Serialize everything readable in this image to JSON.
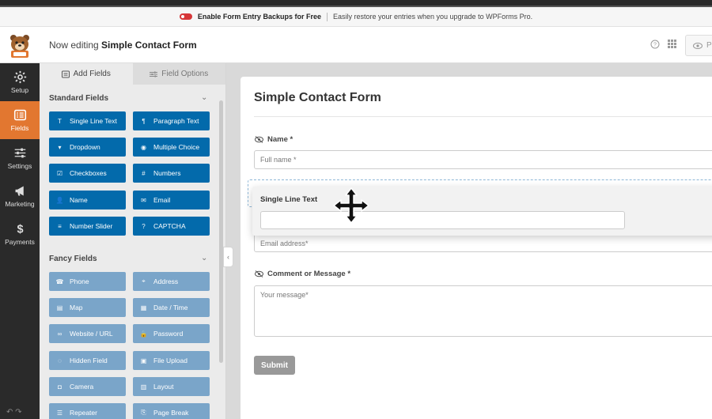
{
  "notice": {
    "title": "Enable Form Entry Backups for Free",
    "description": "Easily restore your entries when you upgrade to WPForms Pro."
  },
  "header": {
    "editing_prefix": "Now editing",
    "form_name": "Simple Contact Form",
    "help_icon": "help-icon",
    "grid_icon": "grid-icon",
    "preview_label": "P"
  },
  "nav": {
    "items": [
      {
        "label": "Setup",
        "icon": "gear-icon"
      },
      {
        "label": "Fields",
        "icon": "fields-list-icon",
        "active": true
      },
      {
        "label": "Settings",
        "icon": "sliders-icon"
      },
      {
        "label": "Marketing",
        "icon": "megaphone-icon"
      },
      {
        "label": "Payments",
        "icon": "dollar-icon"
      }
    ]
  },
  "panel": {
    "tabs": [
      {
        "label": "Add Fields",
        "active": true
      },
      {
        "label": "Field Options",
        "active": false
      }
    ],
    "standard_title": "Standard Fields",
    "standard_fields": [
      {
        "label": "Single Line Text",
        "icon": "T"
      },
      {
        "label": "Paragraph Text",
        "icon": "¶"
      },
      {
        "label": "Dropdown",
        "icon": "▾"
      },
      {
        "label": "Multiple Choice",
        "icon": "◉"
      },
      {
        "label": "Checkboxes",
        "icon": "☑"
      },
      {
        "label": "Numbers",
        "icon": "#"
      },
      {
        "label": "Name",
        "icon": "👤"
      },
      {
        "label": "Email",
        "icon": "✉"
      },
      {
        "label": "Number Slider",
        "icon": "≡"
      },
      {
        "label": "CAPTCHA",
        "icon": "?"
      }
    ],
    "fancy_title": "Fancy Fields",
    "fancy_fields": [
      {
        "label": "Phone",
        "icon": "☎"
      },
      {
        "label": "Address",
        "icon": "⌖"
      },
      {
        "label": "Map",
        "icon": "▤"
      },
      {
        "label": "Date / Time",
        "icon": "▦"
      },
      {
        "label": "Website / URL",
        "icon": "∞"
      },
      {
        "label": "Password",
        "icon": "🔒"
      },
      {
        "label": "Hidden Field",
        "icon": "◌"
      },
      {
        "label": "File Upload",
        "icon": "▣"
      },
      {
        "label": "Camera",
        "icon": "◘"
      },
      {
        "label": "Layout",
        "icon": "▥"
      },
      {
        "label": "Repeater",
        "icon": "☰"
      },
      {
        "label": "Page Break",
        "icon": "⎘"
      }
    ]
  },
  "form": {
    "title": "Simple Contact Form",
    "name_label": "Name *",
    "name_placeholder": "Full name *",
    "drag_label": "Single Line Text",
    "email_placeholder": "Email address*",
    "comment_label": "Comment or Message *",
    "comment_placeholder": "Your message*",
    "submit_label": "Submit"
  },
  "colors": {
    "accent": "#e27730",
    "standard_button": "#036aab",
    "fancy_button": "#7aa5c9",
    "toggle": "#d63638"
  }
}
